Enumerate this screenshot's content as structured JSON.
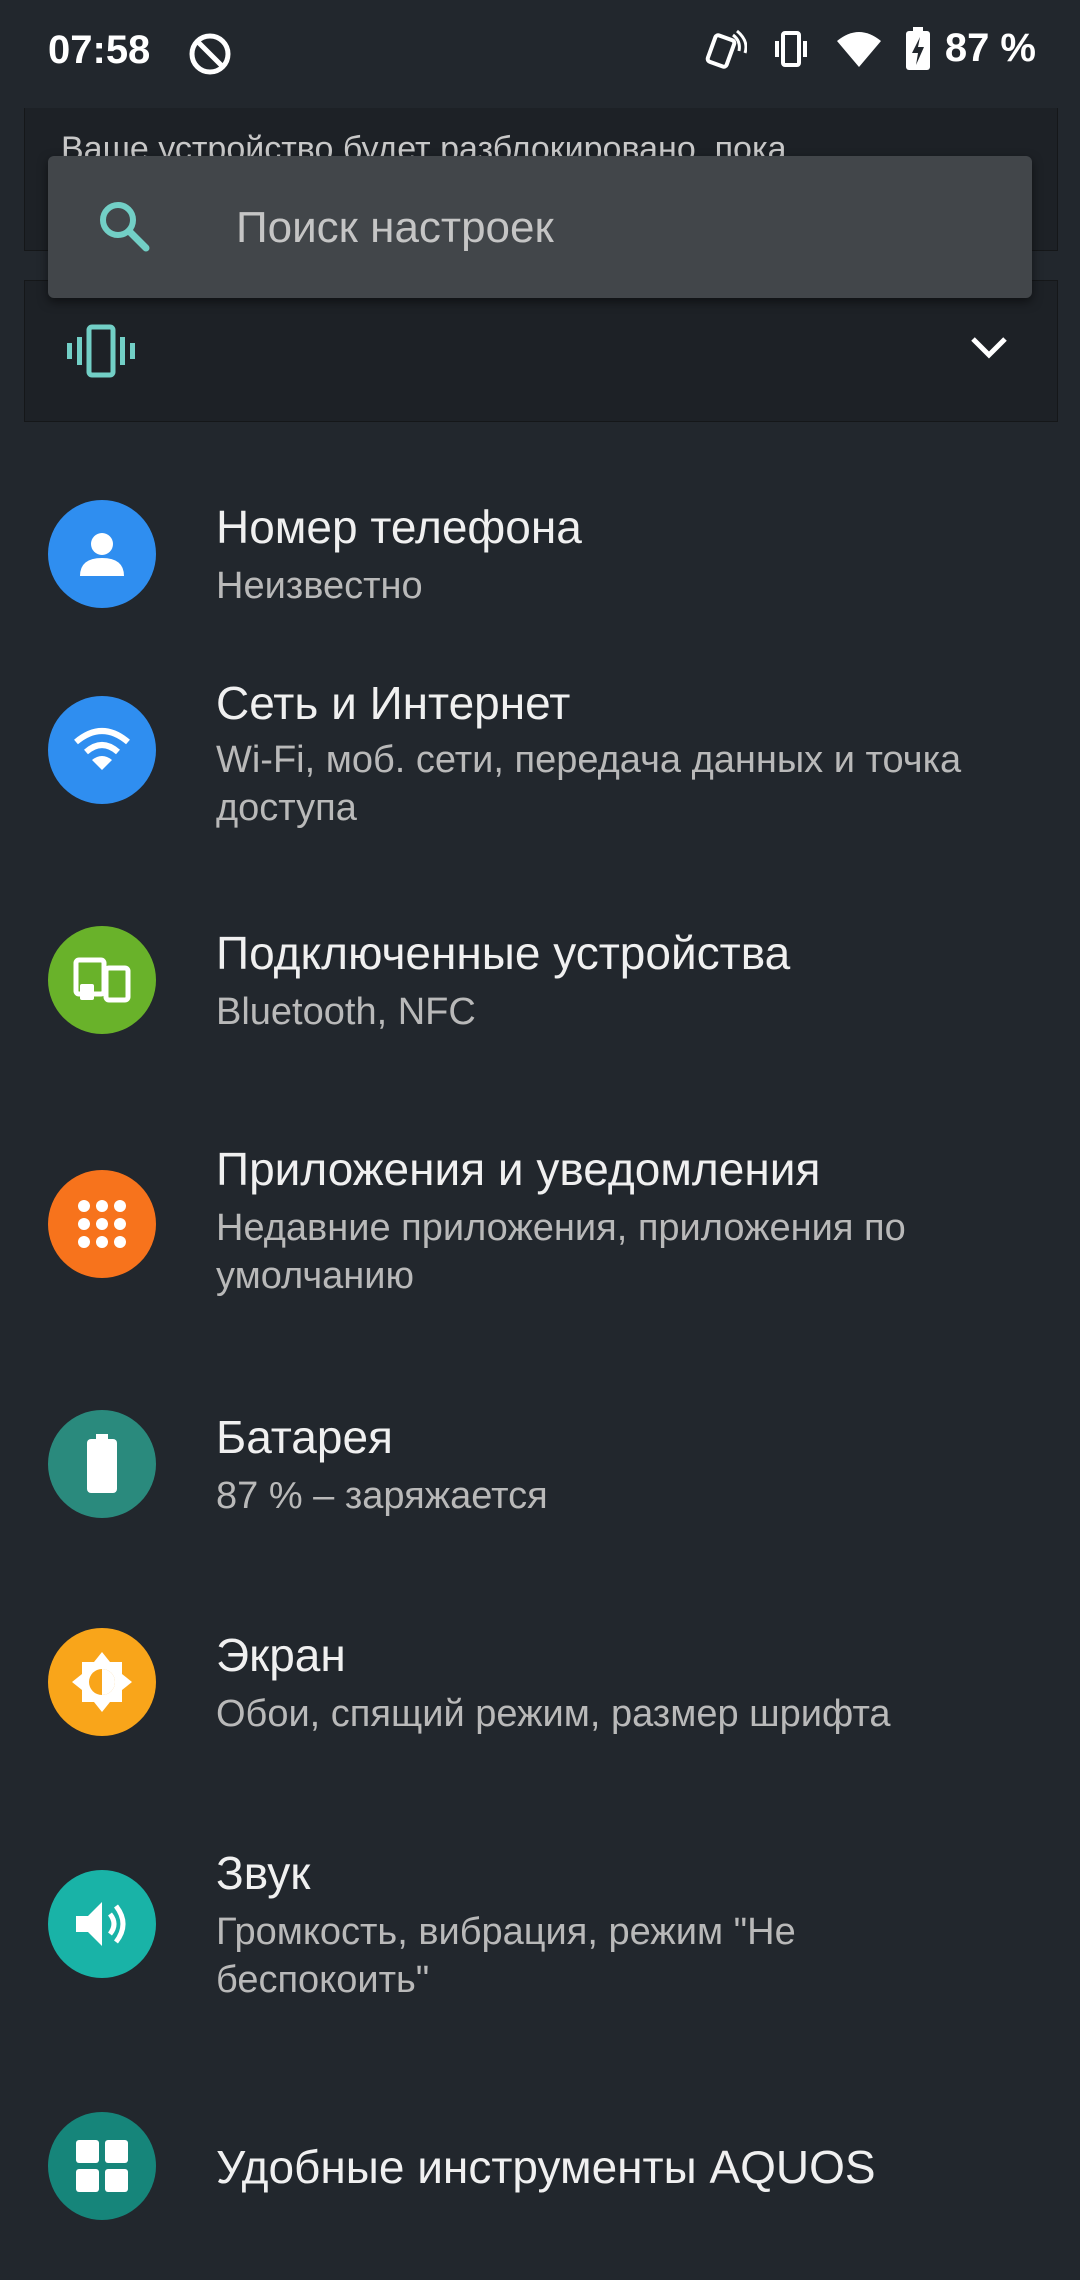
{
  "status_bar": {
    "time": "07:58",
    "battery_text": "87 %",
    "icons": [
      "dnd-icon",
      "nfc-icon",
      "vibrate-icon",
      "wifi-icon",
      "battery-charging-icon"
    ]
  },
  "conditional_card": {
    "text": "Ваше устройство будет разблокировано, пока"
  },
  "search": {
    "placeholder": "Поиск настроек"
  },
  "vibrate_card": {
    "icon": "vibrate-icon",
    "chevron": "chevron-down-icon"
  },
  "settings": [
    {
      "title": "Номер телефона",
      "subtitle": "Неизвестно",
      "icon": "person-icon",
      "color": "#2f8ef0"
    },
    {
      "title": "Сеть и Интернет",
      "subtitle": "Wi-Fi, моб. сети, передача данных и точка доступа",
      "icon": "wifi-icon",
      "color": "#2f8ef0"
    },
    {
      "title": "Подключенные устройства",
      "subtitle": "Bluetooth, NFC",
      "icon": "devices-icon",
      "color": "#69b22a"
    },
    {
      "title": "Приложения и уведомления",
      "subtitle": "Недавние приложения, приложения по умолчанию",
      "icon": "apps-grid-icon",
      "color": "#f7731c"
    },
    {
      "title": "Батарея",
      "subtitle": "87 % – заряжается",
      "icon": "battery-icon",
      "color": "#2a8a7d"
    },
    {
      "title": "Экран",
      "subtitle": "Обои, спящий режим, размер шрифта",
      "icon": "brightness-icon",
      "color": "#f9a51a"
    },
    {
      "title": "Звук",
      "subtitle": "Громкость, вибрация, режим \"Не беспокоить\"",
      "icon": "volume-icon",
      "color": "#19b3a7"
    },
    {
      "title": "Удобные инструменты AQUOS",
      "subtitle": "",
      "icon": "tools-grid-icon",
      "color": "#16857a"
    }
  ]
}
